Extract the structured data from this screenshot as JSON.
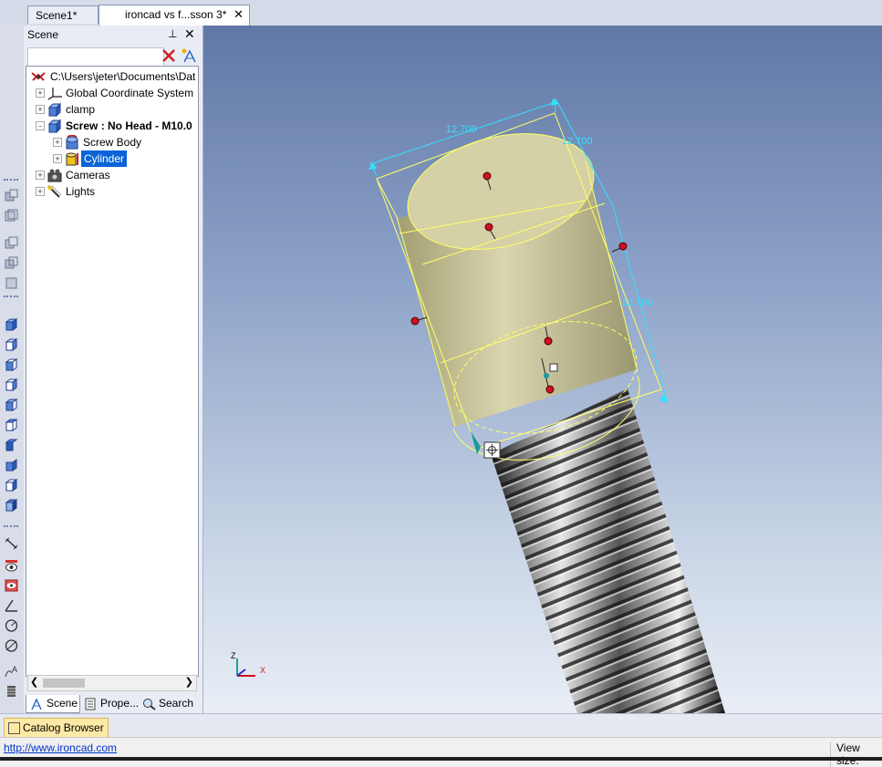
{
  "tabs": [
    {
      "label": "Scene1*",
      "active": false
    },
    {
      "label": "ironcad vs f...sson 3*",
      "active": true,
      "close": "✕"
    }
  ],
  "scene_panel": {
    "title": "Scene",
    "pin_glyph": "⊥",
    "close_glyph": "✕",
    "filter_value": "",
    "tree": [
      {
        "label": "C:\\Users\\jeter\\Documents\\Dat",
        "icon": "scene-root-icon",
        "level": 0
      },
      {
        "label": "Global Coordinate System",
        "icon": "coordinate-system-icon",
        "level": 1,
        "expander": "+"
      },
      {
        "label": "clamp",
        "icon": "part-icon",
        "level": 1,
        "expander": "+"
      },
      {
        "label": "Screw : No Head - M10.0",
        "icon": "part-icon",
        "level": 1,
        "expander": "-",
        "bold": true
      },
      {
        "label": "Screw Body",
        "icon": "screw-body-icon",
        "level": 2,
        "expander": "+"
      },
      {
        "label": "Cylinder",
        "icon": "cylinder-icon",
        "level": 2,
        "expander": "+",
        "selected": true
      },
      {
        "label": "Cameras",
        "icon": "camera-icon",
        "level": 1,
        "expander": "+"
      },
      {
        "label": "Lights",
        "icon": "light-icon",
        "level": 1,
        "expander": "+"
      }
    ],
    "bottom_tabs": [
      {
        "label": "Scene",
        "icon": "scene-tab-icon",
        "active": true
      },
      {
        "label": "Prope...",
        "icon": "properties-icon",
        "active": false
      },
      {
        "label": "Search",
        "icon": "search-icon",
        "active": false
      }
    ]
  },
  "viewport": {
    "dimensions": [
      "12.700",
      "12.700",
      "12.700"
    ],
    "axes": {
      "z": "Z",
      "x": "X"
    },
    "colors": {
      "dimension": "#33e0ff",
      "handle": "#cc1122",
      "selection": "#ffff66"
    }
  },
  "catalog_browser_label": "Catalog Browser",
  "status": {
    "link": "http://www.ironcad.com",
    "view_size_label": "View size:"
  }
}
